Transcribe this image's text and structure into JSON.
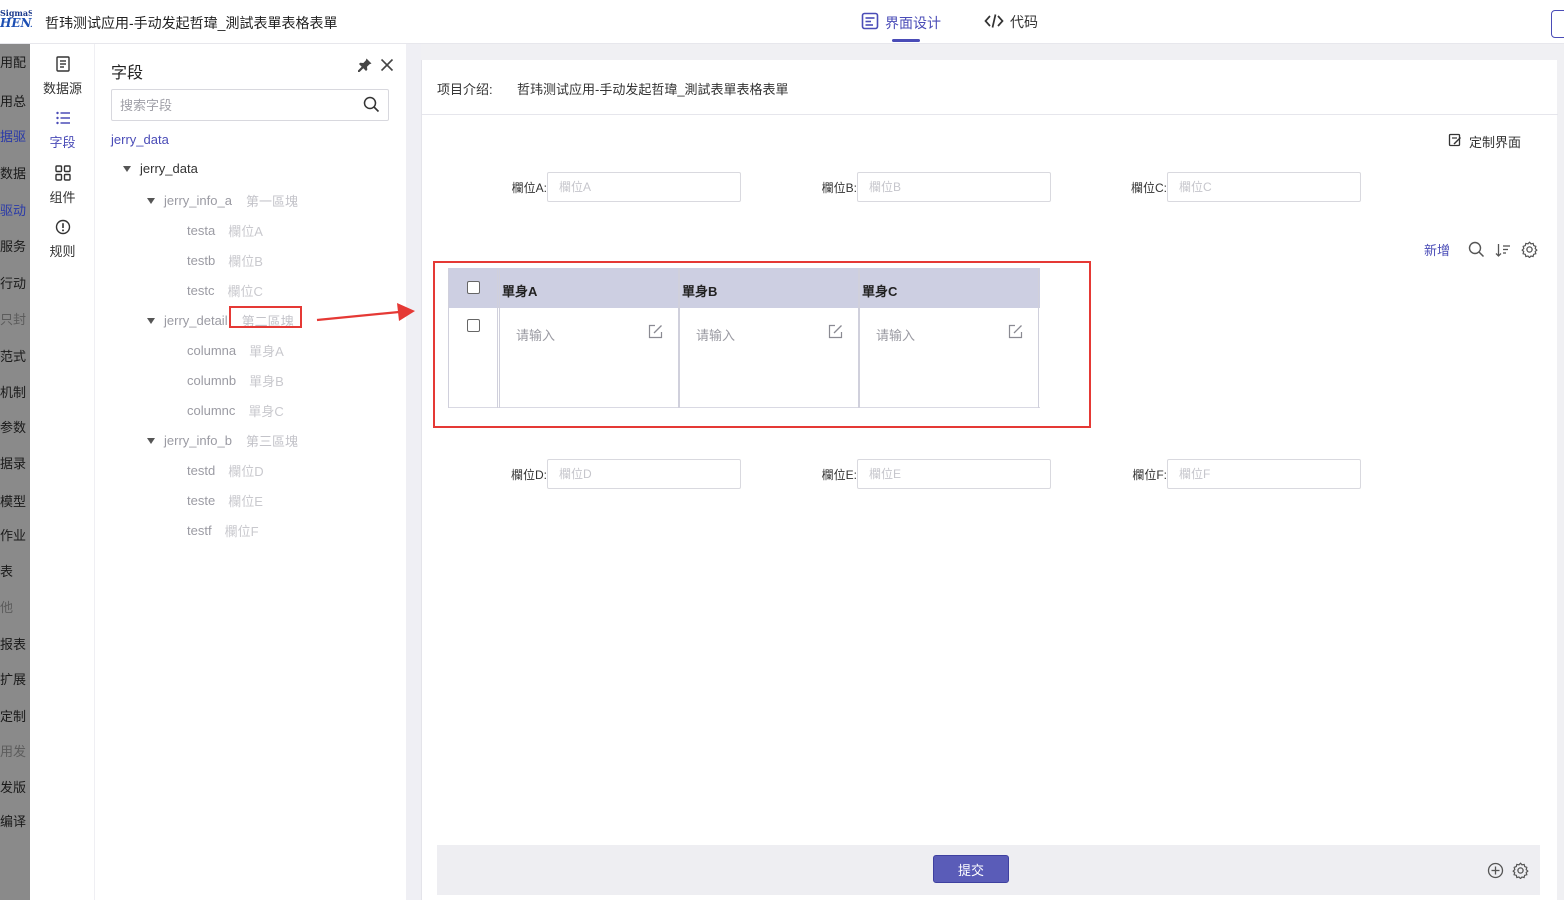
{
  "app": {
    "logo_line1": "SigmaSoft",
    "logo_line2": "HENA",
    "title": "哲玮测试应用-手动发起哲瑋_測試表單表格表單",
    "tabs": [
      {
        "label": "界面设计",
        "active": true,
        "icon": "layout-icon"
      },
      {
        "label": "代码",
        "active": false,
        "icon": "code-icon"
      }
    ]
  },
  "backdrop_menu": [
    "用配",
    "用总",
    "据驱",
    "数据",
    "驱动",
    "服务",
    "行动",
    "只封",
    "范式",
    "机制",
    "参数",
    "据录",
    "模型",
    "作业",
    "表",
    "他",
    "报表",
    "扩展",
    "定制",
    "用发",
    "发版",
    "编译"
  ],
  "rail": {
    "items": [
      {
        "label": "数据源",
        "icon": "datasource-icon",
        "active": false
      },
      {
        "label": "字段",
        "icon": "list-icon",
        "active": true
      },
      {
        "label": "组件",
        "icon": "grid-icon",
        "active": false
      },
      {
        "label": "规则",
        "icon": "alert-icon",
        "active": false
      }
    ]
  },
  "field_panel": {
    "title": "字段",
    "search_placeholder": "搜索字段",
    "root_link": "jerry_data",
    "tree": {
      "root": "jerry_data",
      "groups": [
        {
          "name": "jerry_info_a",
          "label": "第一區塊",
          "children": [
            {
              "name": "testa",
              "label": "欄位A"
            },
            {
              "name": "testb",
              "label": "欄位B"
            },
            {
              "name": "testc",
              "label": "欄位C"
            }
          ]
        },
        {
          "name": "jerry_detail",
          "label": "第二區塊",
          "children": [
            {
              "name": "columna",
              "label": "單身A"
            },
            {
              "name": "columnb",
              "label": "單身B"
            },
            {
              "name": "columnc",
              "label": "單身C"
            }
          ]
        },
        {
          "name": "jerry_info_b",
          "label": "第三區塊",
          "children": [
            {
              "name": "testd",
              "label": "欄位D"
            },
            {
              "name": "teste",
              "label": "欄位E"
            },
            {
              "name": "testf",
              "label": "欄位F"
            }
          ]
        }
      ]
    }
  },
  "main": {
    "intro_label": "项目介绍:",
    "intro_value": "哲玮测试应用-手动发起哲瑋_測試表單表格表單",
    "custom_ui_label": "定制界面",
    "form_top": [
      {
        "label": "欄位A:",
        "placeholder": "欄位A"
      },
      {
        "label": "欄位B:",
        "placeholder": "欄位B"
      },
      {
        "label": "欄位C:",
        "placeholder": "欄位C"
      }
    ],
    "form_bottom": [
      {
        "label": "欄位D:",
        "placeholder": "欄位D"
      },
      {
        "label": "欄位E:",
        "placeholder": "欄位E"
      },
      {
        "label": "欄位F:",
        "placeholder": "欄位F"
      }
    ],
    "table_toolbar": {
      "add_label": "新增"
    },
    "subtable": {
      "columns": [
        "單身A",
        "單身B",
        "單身C"
      ],
      "cell_placeholder": "请输入"
    },
    "submit_label": "提交"
  },
  "colors": {
    "accent": "#4a4cb7",
    "highlight": "#e53935",
    "table_header": "#cdcfe2",
    "submit": "#5a5cb8"
  }
}
